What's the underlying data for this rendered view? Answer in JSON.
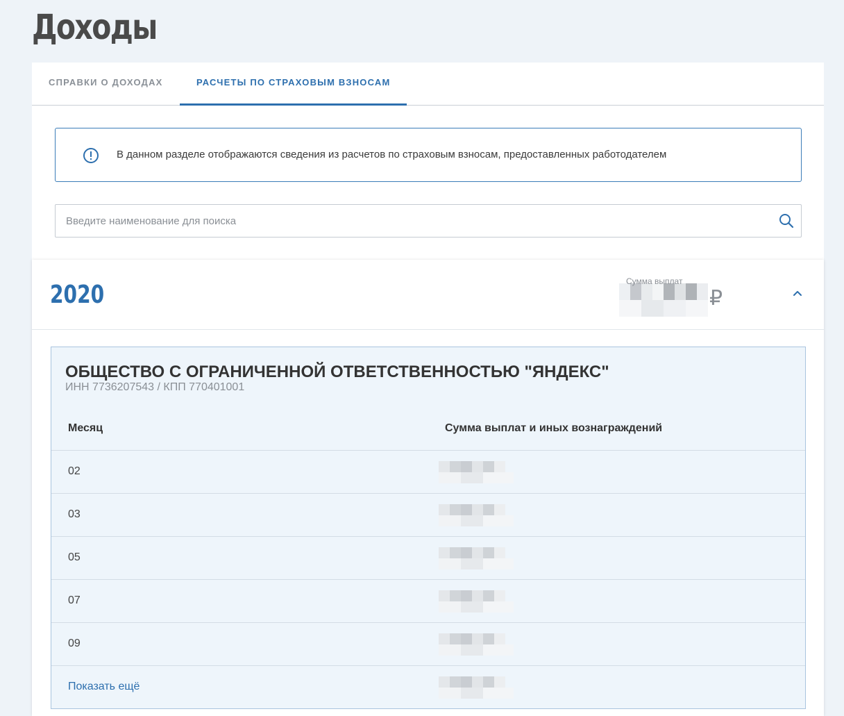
{
  "page": {
    "title": "Доходы"
  },
  "tabs": [
    {
      "label": "Справки о доходах",
      "active": false
    },
    {
      "label": "Расчеты по страховым взносам",
      "active": true
    }
  ],
  "notice": {
    "icon": "info-icon",
    "text": "В данном разделе отображаются сведения из расчетов по страховым взносам, предоставленных работодателем"
  },
  "search": {
    "placeholder": "Введите наименование для поиска",
    "value": "",
    "icon": "search-icon"
  },
  "year_panel": {
    "year": "2020",
    "sum_label": "Сумма выплат",
    "sum_value_redacted": true,
    "currency": "₽",
    "expanded": true
  },
  "organization": {
    "name": "ОБЩЕСТВО С ОГРАНИЧЕННОЙ ОТВЕТСТВЕННОСТЬЮ \"ЯНДЕКС\"",
    "ids": "ИНН 7736207543 / КПП 770401001",
    "table": {
      "headers": {
        "month": "Месяц",
        "sum": "Сумма выплат и иных вознаграждений"
      },
      "rows": [
        {
          "month": "02",
          "sum_redacted": true
        },
        {
          "month": "03",
          "sum_redacted": true
        },
        {
          "month": "05",
          "sum_redacted": true
        },
        {
          "month": "07",
          "sum_redacted": true
        },
        {
          "month": "09",
          "sum_redacted": true
        }
      ],
      "show_more": "Показать ещё"
    }
  },
  "colors": {
    "accent": "#2d6fae",
    "background": "#eef3f8",
    "org_background": "#eef5fb",
    "muted_text": "#8a8f95"
  }
}
